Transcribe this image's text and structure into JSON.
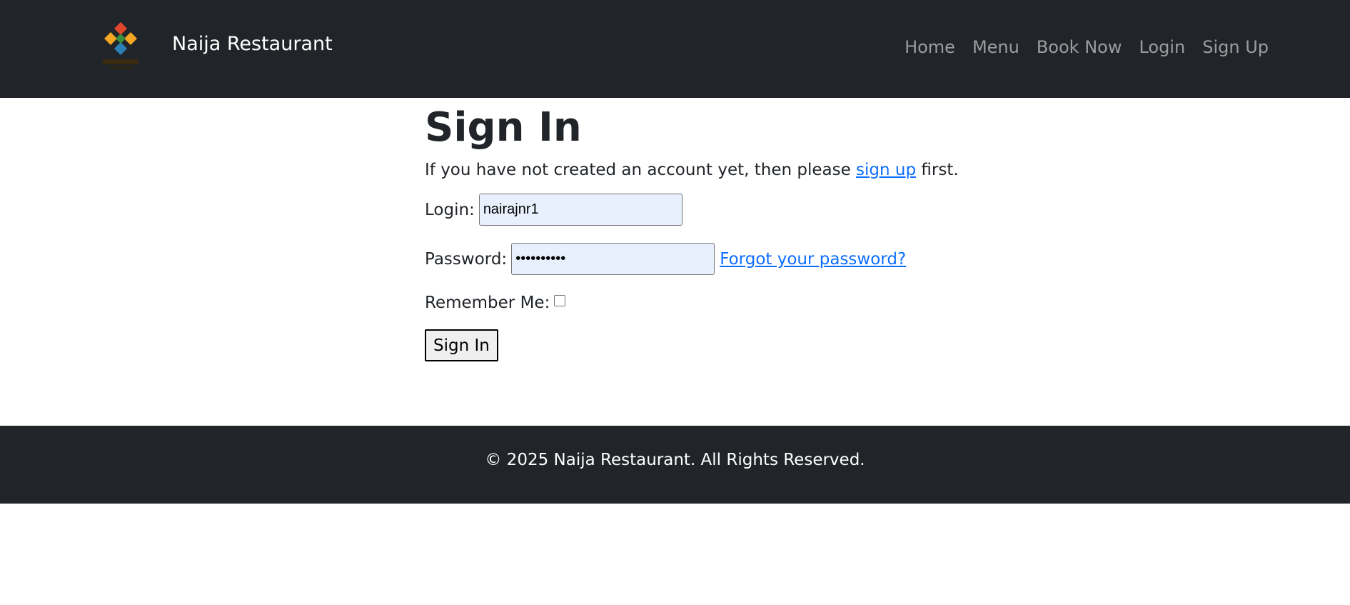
{
  "navbar": {
    "brand_name": "Naija Restaurant",
    "logo_icon": "naija-diamond-logo",
    "links": [
      {
        "label": "Home"
      },
      {
        "label": "Menu"
      },
      {
        "label": "Book Now"
      },
      {
        "label": "Login"
      },
      {
        "label": "Sign Up"
      }
    ]
  },
  "signin": {
    "title": "Sign In",
    "intro_before": "If you have not created an account yet, then please ",
    "intro_link": "sign up",
    "intro_after": " first.",
    "login_label": "Login:",
    "login_value": "nairajnr1",
    "password_label": "Password:",
    "password_value": "••••••••••",
    "forgot_link": "Forgot your password?",
    "remember_label": "Remember Me:",
    "remember_checked": false,
    "submit_label": "Sign In"
  },
  "footer": {
    "text": "© 2025 Naija Restaurant. All Rights Reserved."
  },
  "colors": {
    "navbar_bg": "#212529",
    "link": "#0d6efd",
    "autofill_bg": "#e8f0fe"
  }
}
